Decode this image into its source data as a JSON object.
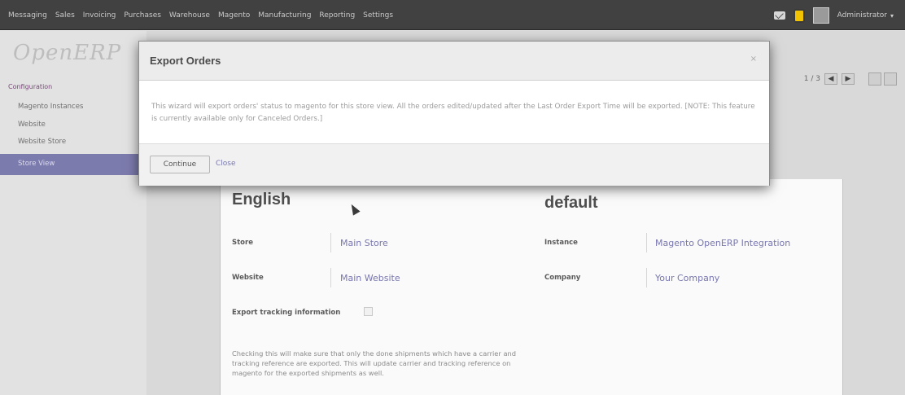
{
  "topbar": {
    "menu": [
      "Messaging",
      "Sales",
      "Invoicing",
      "Purchases",
      "Warehouse",
      "Magento",
      "Manufacturing",
      "Reporting",
      "Settings"
    ],
    "user": "Administrator"
  },
  "sidebar": {
    "logo": "OpenERP",
    "section": "Configuration",
    "items": [
      "Magento Instances",
      "Website",
      "Website Store",
      "Store View"
    ],
    "active_index": 3
  },
  "pager": {
    "text": "1 / 3",
    "prev": "◀",
    "next": "▶"
  },
  "sheet": {
    "title_left": "English",
    "title_right": "default",
    "store_label": "Store",
    "store_value": "Main Store",
    "instance_label": "Instance",
    "instance_value": "Magento OpenERP Integration",
    "website_label": "Website",
    "website_value": "Main Website",
    "company_label": "Company",
    "company_value": "Your Company",
    "export_tracking_label": "Export tracking information",
    "export_tracking_checked": false,
    "help_text": "Checking this will make sure that only the done shipments which have a carrier and tracking reference are exported. This will update carrier and tracking reference on magento for the exported shipments as well."
  },
  "modal": {
    "title": "Export Orders",
    "close_symbol": "×",
    "body": "This wizard will export orders' status to magento for this store view. All the orders edited/updated after the Last Order Export Time will be exported. [NOTE: This feature is currently available only for Canceled Orders.]",
    "continue_label": "Continue",
    "close_label": "Close"
  }
}
